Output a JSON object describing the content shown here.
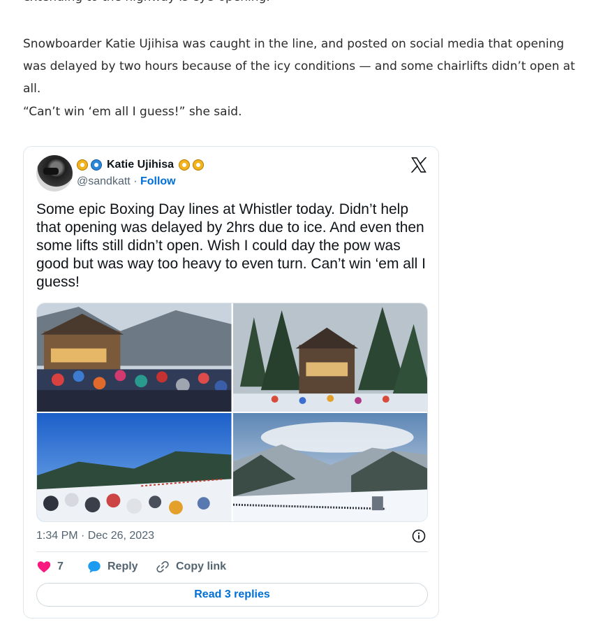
{
  "article": {
    "paragraph_top": "extending to the highway is eye-opening.",
    "paragraph_1": "Snowboarder Katie Ujihisa was caught in the line, and posted on social media that opening was delayed by two hours because of the icy conditions — and some chairlifts didn’t open at all.",
    "paragraph_2": "“Can’t win ‘em all I guess!” she said."
  },
  "tweet": {
    "author_name": "Katie Ujihisa",
    "handle": "@sandkatt",
    "separator": "·",
    "follow_label": "Follow",
    "text": "Some epic Boxing Day lines at Whistler today. Didn’t help that opening was delayed by 2hrs due to ice. And even then some lifts still didn’t open. Wish I could day the pow was good but was way too heavy to even turn. Can’t win ‘em all I guess!",
    "timestamp": "1:34 PM · Dec 26, 2023",
    "like_count": "7",
    "reply_label": "Reply",
    "copy_link_label": "Copy link",
    "read_replies_label": "Read 3 replies",
    "icons": {
      "emoji": "sun-face-emoji",
      "logo": "x-logo-icon",
      "info": "info-icon",
      "like": "heart-icon",
      "reply": "speech-bubble-icon",
      "copy": "link-icon"
    },
    "colors": {
      "link": "#006fd6",
      "heart": "#f91880",
      "reply_bubble": "#1d9bf0",
      "muted": "#536471"
    }
  }
}
